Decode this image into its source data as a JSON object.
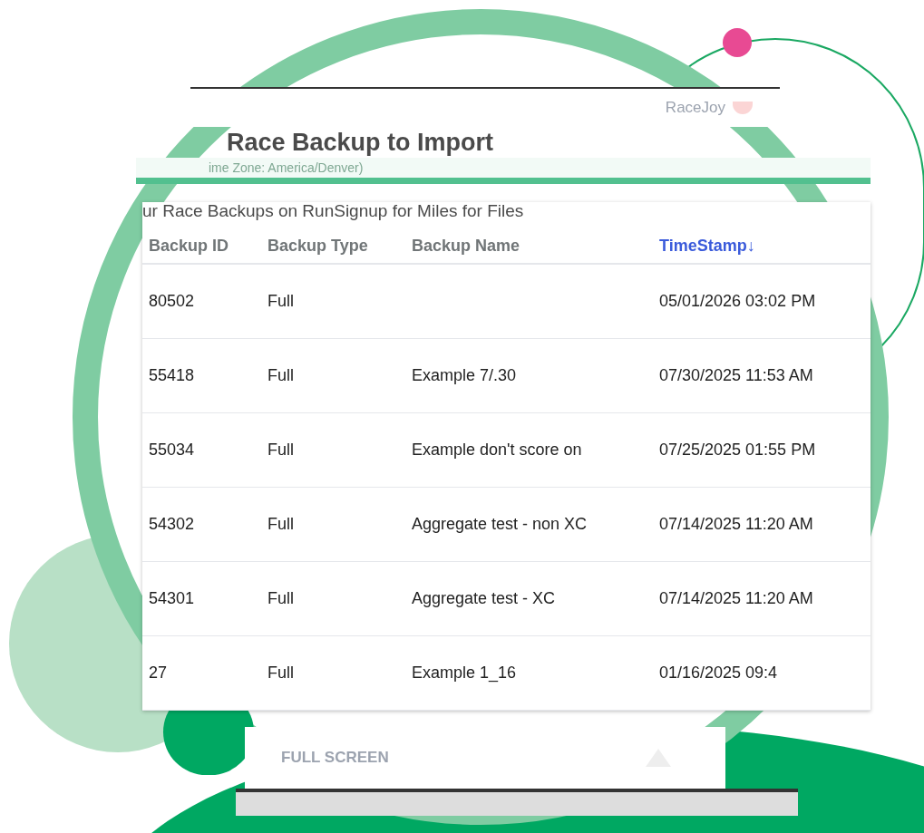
{
  "top_bar": {
    "brand": "RaceJoy"
  },
  "dialog": {
    "title": "Race Backup to Import",
    "subtitle": "ime Zone: America/Denver)"
  },
  "card": {
    "heading": "ur Race Backups on RunSignup for Miles for Files"
  },
  "table": {
    "columns": [
      {
        "label": "Backup ID",
        "sorted": false
      },
      {
        "label": "Backup Type",
        "sorted": false
      },
      {
        "label": "Backup Name",
        "sorted": false
      },
      {
        "label": "TimeStamp↓",
        "sorted": true
      }
    ],
    "rows": [
      {
        "cells": [
          "80502",
          "Full",
          "",
          "05/01/2026 03:02 PM"
        ]
      },
      {
        "cells": [
          "55418",
          "Full",
          "Example 7/.30",
          "07/30/2025 11:53 AM"
        ]
      },
      {
        "cells": [
          "55034",
          "Full",
          "Example don't score on",
          "07/25/2025 01:55 PM"
        ]
      },
      {
        "cells": [
          "54302",
          "Full",
          "Aggregate test - non XC",
          "07/14/2025 11:20 AM"
        ]
      },
      {
        "cells": [
          "54301",
          "Full",
          "Aggregate test - XC",
          "07/14/2025 11:20 AM"
        ]
      },
      {
        "cells": [
          "27",
          "Full",
          "Example 1_16",
          "01/16/2025 09:4"
        ]
      }
    ]
  },
  "footer": {
    "label": "FULL SCREEN"
  }
}
